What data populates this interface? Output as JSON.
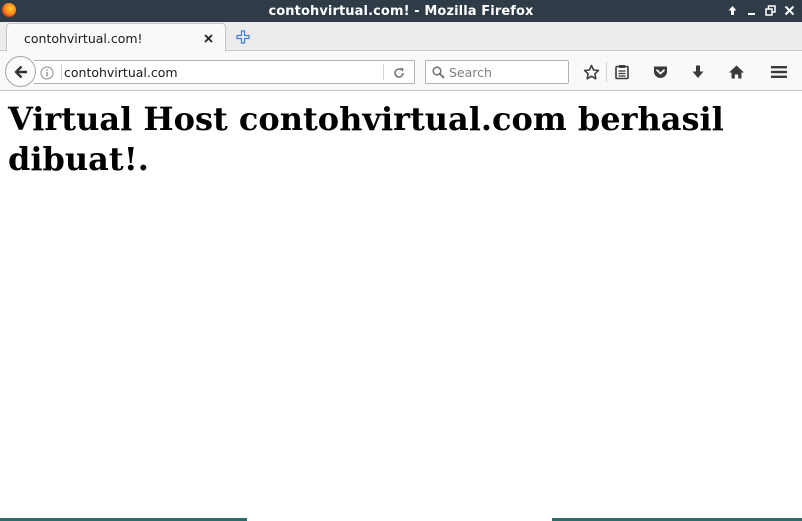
{
  "window": {
    "title": "contohvirtual.com! - Mozilla Firefox"
  },
  "tabs": [
    {
      "label": "contohvirtual.com!",
      "active": true
    }
  ],
  "navbar": {
    "url": "contohvirtual.com",
    "search_placeholder": "Search"
  },
  "page": {
    "heading": "Virtual Host contohvirtual.com berhasil dibuat!."
  },
  "icons": {
    "back": "arrow-left-icon",
    "info": "info-icon",
    "reload": "reload-icon",
    "search": "magnifier-icon",
    "bookmark": "star-icon",
    "library": "clipboard-icon",
    "pocket": "pocket-icon",
    "download": "download-arrow-icon",
    "home": "home-icon",
    "menu": "hamburger-icon",
    "new_tab": "plus-icon"
  },
  "colors": {
    "titlebar_bg": "#2f3c47",
    "new_tab_accent": "#3d7fc7",
    "bottom_strip": "#2e6b6b"
  }
}
